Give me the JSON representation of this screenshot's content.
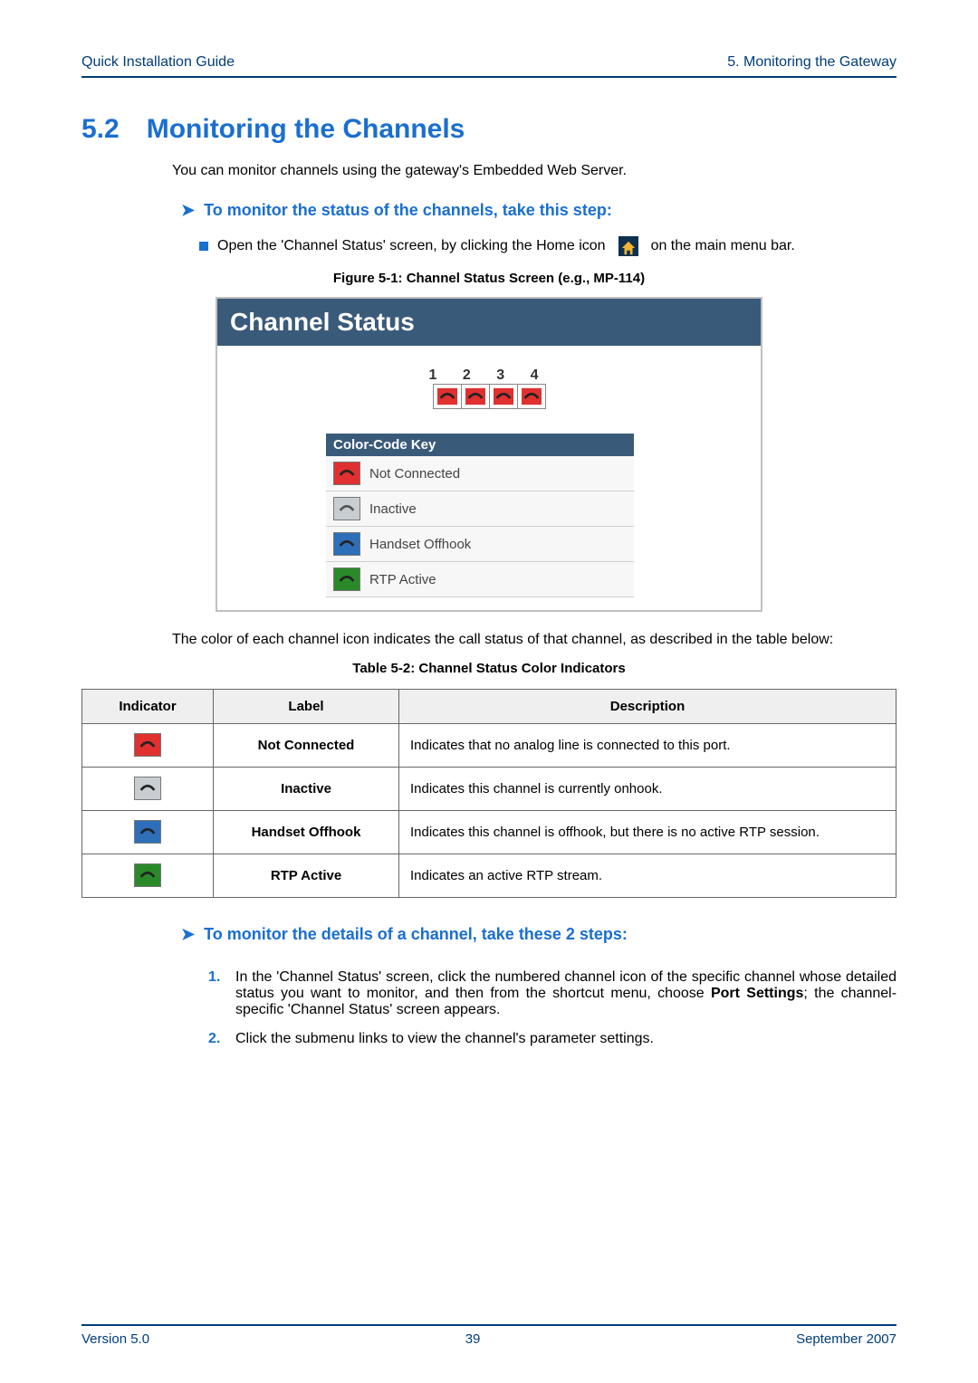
{
  "header": {
    "left": "Quick Installation Guide",
    "right": "5. Monitoring the Gateway"
  },
  "section": {
    "num": "5.2",
    "title": "Monitoring the Channels"
  },
  "intro": "You can monitor channels using the gateway's Embedded Web Server.",
  "substep1": "To monitor the status of the channels, take this step:",
  "bullet1_pre": "Open the 'Channel Status' screen, by clicking the Home icon",
  "bullet1_post": "on the main menu bar.",
  "figure_caption": "Figure 5-1: Channel Status Screen (e.g., MP-114)",
  "cs": {
    "title": "Channel Status",
    "ch_nums": "1  2  3  4",
    "key_title": "Color-Code Key",
    "keys": [
      "Not Connected",
      "Inactive",
      "Handset Offhook",
      "RTP Active"
    ]
  },
  "below_text": "The color of each channel icon indicates the call status of that channel, as described in the table below:",
  "table_caption": "Table 5-2: Channel Status Color Indicators",
  "table": {
    "headers": [
      "Indicator",
      "Label",
      "Description"
    ],
    "rows": [
      {
        "cls": "ind-red",
        "label": "Not Connected",
        "desc": "Indicates that no analog line is connected to this port."
      },
      {
        "cls": "ind-grey",
        "label": "Inactive",
        "desc": "Indicates this channel is currently onhook."
      },
      {
        "cls": "ind-blue",
        "label": "Handset Offhook",
        "desc": "Indicates this channel is offhook, but there is no active RTP session."
      },
      {
        "cls": "ind-green",
        "label": "RTP Active",
        "desc": "Indicates an active RTP stream."
      }
    ]
  },
  "substep2": "To monitor the details of a channel, take these 2 steps:",
  "steps": [
    "In the 'Channel Status' screen, click the numbered channel icon of the specific channel whose detailed status you want to monitor, and then from the shortcut menu, choose <b>Port Settings</b>; the channel-specific 'Channel Status' screen appears.",
    "Click the submenu links to view the channel's parameter settings."
  ],
  "footer": {
    "left": "Version 5.0",
    "center": "39",
    "right": "September 2007"
  }
}
